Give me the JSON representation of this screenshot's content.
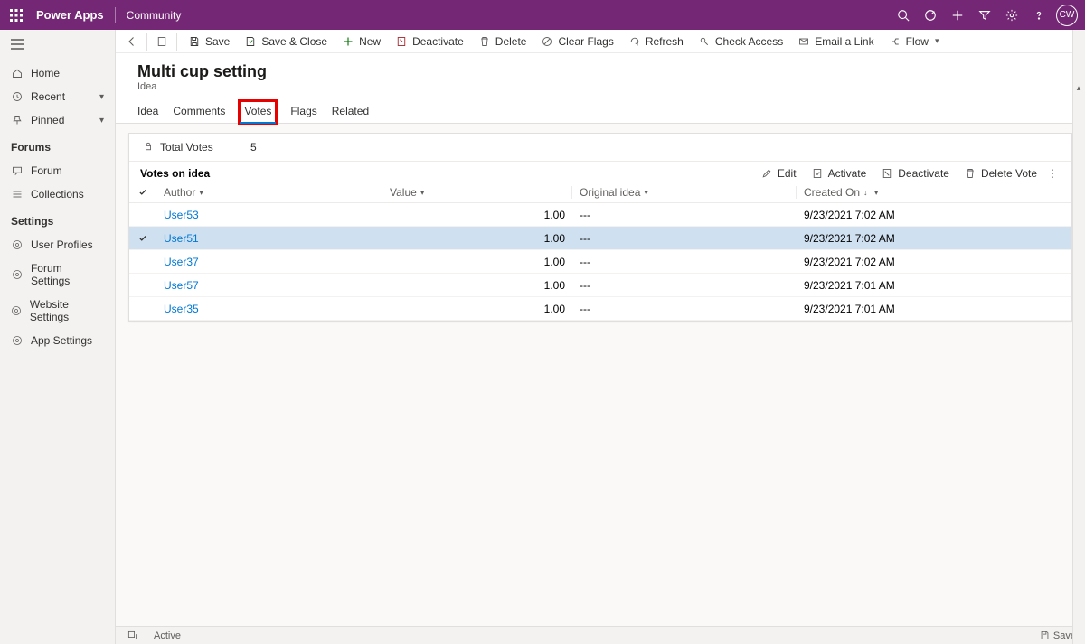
{
  "topbar": {
    "app_name": "Power Apps",
    "area_name": "Community",
    "avatar_initials": "CW"
  },
  "sidenav": {
    "home": "Home",
    "recent": "Recent",
    "pinned": "Pinned",
    "group_forums": "Forums",
    "forum": "Forum",
    "collections": "Collections",
    "group_settings": "Settings",
    "user_profiles": "User Profiles",
    "forum_settings": "Forum Settings",
    "website_settings": "Website Settings",
    "app_settings": "App Settings"
  },
  "cmdbar": {
    "save": "Save",
    "save_close": "Save & Close",
    "new": "New",
    "deactivate": "Deactivate",
    "delete": "Delete",
    "clear_flags": "Clear Flags",
    "refresh": "Refresh",
    "check_access": "Check Access",
    "email_link": "Email a Link",
    "flow": "Flow"
  },
  "header": {
    "title": "Multi cup setting",
    "subtitle": "Idea"
  },
  "tabs": {
    "idea": "Idea",
    "comments": "Comments",
    "votes": "Votes",
    "flags": "Flags",
    "related": "Related"
  },
  "totals": {
    "label": "Total Votes",
    "value": "5"
  },
  "subgrid": {
    "title": "Votes on idea",
    "actions": {
      "edit": "Edit",
      "activate": "Activate",
      "deactivate": "Deactivate",
      "delete": "Delete Vote"
    },
    "columns": {
      "author": "Author",
      "value": "Value",
      "original": "Original idea",
      "created": "Created On"
    },
    "rows": [
      {
        "author": "User53",
        "value": "1.00",
        "original": "---",
        "created": "9/23/2021 7:02 AM",
        "selected": false
      },
      {
        "author": "User51",
        "value": "1.00",
        "original": "---",
        "created": "9/23/2021 7:02 AM",
        "selected": true
      },
      {
        "author": "User37",
        "value": "1.00",
        "original": "---",
        "created": "9/23/2021 7:02 AM",
        "selected": false
      },
      {
        "author": "User57",
        "value": "1.00",
        "original": "---",
        "created": "9/23/2021 7:01 AM",
        "selected": false
      },
      {
        "author": "User35",
        "value": "1.00",
        "original": "---",
        "created": "9/23/2021 7:01 AM",
        "selected": false
      }
    ]
  },
  "status": {
    "state": "Active",
    "save": "Save"
  }
}
